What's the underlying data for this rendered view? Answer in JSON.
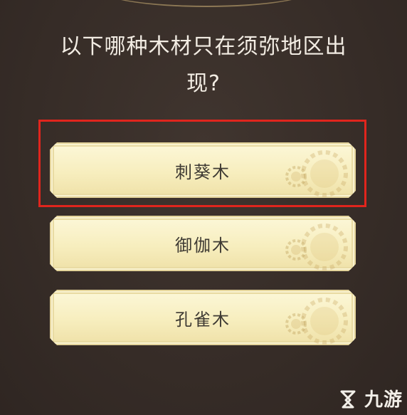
{
  "question": {
    "text_line1": "以下哪种木材只在须弥地区出",
    "text_line2": "现?"
  },
  "options": [
    {
      "label": "刺葵木",
      "highlighted": true
    },
    {
      "label": "御伽木",
      "highlighted": false
    },
    {
      "label": "孔雀木",
      "highlighted": false
    }
  ],
  "watermark": {
    "text": "九游",
    "icon": "jiuyou-logo-icon"
  },
  "colors": {
    "background": "#3a302b",
    "option_fill": "#f7eebe",
    "highlight_border": "#e0251d",
    "question_text": "#f2ece3"
  }
}
